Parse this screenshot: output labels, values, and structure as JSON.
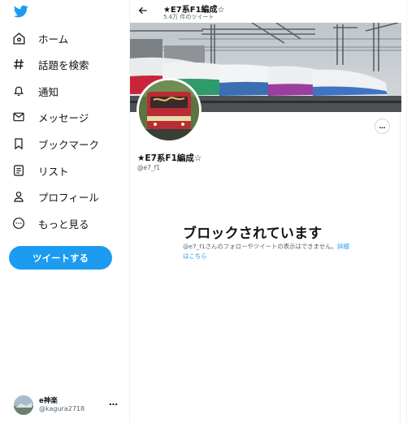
{
  "sidebar": {
    "items": [
      {
        "icon": "home-icon",
        "label": "ホーム"
      },
      {
        "icon": "hashtag-icon",
        "label": "話題を検索"
      },
      {
        "icon": "bell-icon",
        "label": "通知"
      },
      {
        "icon": "mail-icon",
        "label": "メッセージ"
      },
      {
        "icon": "bookmark-icon",
        "label": "ブックマーク"
      },
      {
        "icon": "list-icon",
        "label": "リスト"
      },
      {
        "icon": "profile-icon",
        "label": "プロフィール"
      },
      {
        "icon": "more-circle-icon",
        "label": "もっと見る"
      }
    ],
    "tweet_button": "ツイートする",
    "account": {
      "name": "e神楽",
      "handle": "@kagura2718",
      "more": "…"
    }
  },
  "header": {
    "title": "★E7系F1編成☆",
    "subtitle": "5.4万 件のツイート"
  },
  "profile": {
    "name": "★E7系F1編成☆",
    "handle": "@e7_f1",
    "more": "…"
  },
  "blocked": {
    "title": "ブロックされています",
    "message": "@e7_f1さんのフォローやツイートの表示はできません。",
    "link": "詳細はこちら"
  },
  "colors": {
    "accent": "#1d9bf0",
    "text": "#0f1419",
    "muted": "#536471"
  }
}
